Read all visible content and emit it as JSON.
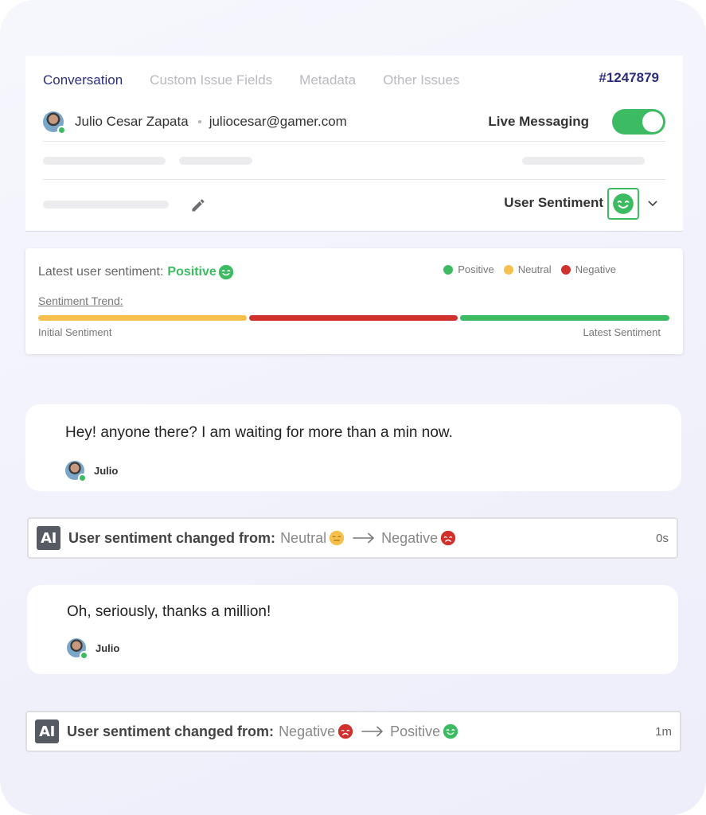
{
  "header": {
    "tabs": [
      {
        "label": "Conversation",
        "active": true
      },
      {
        "label": "Custom Issue Fields",
        "active": false
      },
      {
        "label": "Metadata",
        "active": false
      },
      {
        "label": "Other Issues",
        "active": false
      }
    ],
    "ticket_id": "#1247879",
    "user": {
      "name": "Julio Cesar Zapata",
      "email": "juliocesar@gamer.com",
      "online": true
    },
    "live_messaging": {
      "label": "Live Messaging",
      "enabled": true
    },
    "user_sentiment": {
      "label": "User Sentiment",
      "icon": "happy-face-icon"
    }
  },
  "sentiment_panel": {
    "latest_label": "Latest user sentiment:",
    "latest_value": "Positive",
    "legend": [
      {
        "label": "Positive",
        "color": "#3dbb63"
      },
      {
        "label": "Neutral",
        "color": "#f5c04d"
      },
      {
        "label": "Negative",
        "color": "#d0312d"
      }
    ],
    "trend_label": "Sentiment Trend:",
    "trend": [
      "Neutral",
      "Negative",
      "Positive"
    ],
    "initial_label": "Initial Sentiment",
    "latest_trend_label": "Latest Sentiment"
  },
  "messages": [
    {
      "text": "Hey! anyone there? I am waiting for more than a min now.",
      "author": "Julio"
    },
    {
      "text": "Oh, seriously, thanks a million!",
      "author": "Julio"
    }
  ],
  "ai_events": [
    {
      "badge": "AI",
      "label": "User sentiment changed from:",
      "from": "Neutral",
      "to": "Negative",
      "time": "0s"
    },
    {
      "badge": "AI",
      "label": "User sentiment changed from:",
      "from": "Negative",
      "to": "Positive",
      "time": "1m"
    }
  ],
  "colors": {
    "positive": "#3dbb63",
    "neutral": "#f5c04d",
    "negative": "#d0312d",
    "accent": "#2b2f7a"
  }
}
